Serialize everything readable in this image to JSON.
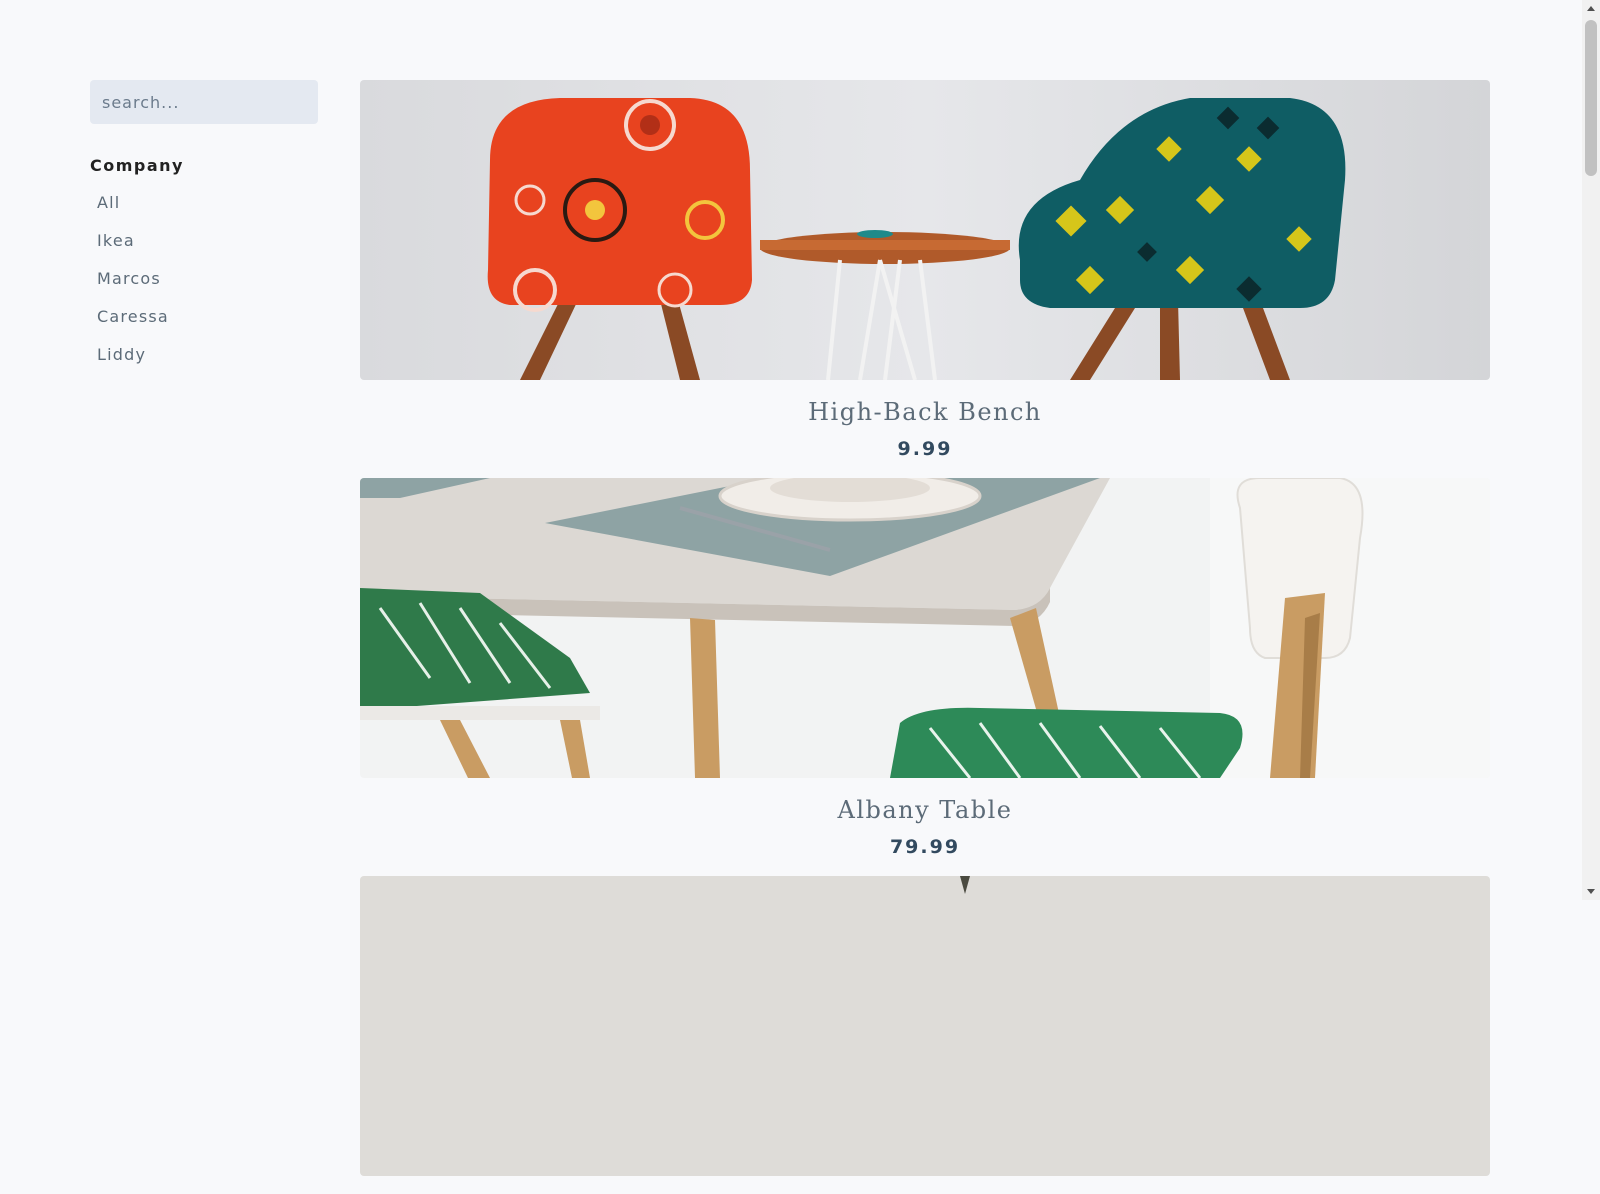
{
  "search": {
    "placeholder": "search..."
  },
  "sidebar": {
    "title": "Company",
    "items": [
      {
        "label": "All"
      },
      {
        "label": "Ikea"
      },
      {
        "label": "Marcos"
      },
      {
        "label": "Caressa"
      },
      {
        "label": "Liddy"
      }
    ]
  },
  "products": [
    {
      "name": "High-Back Bench",
      "price": "9.99",
      "image": "two-patterned-armchairs-with-side-table"
    },
    {
      "name": "Albany Table",
      "price": "79.99",
      "image": "white-dining-table-with-chair-and-cushions"
    },
    {
      "name": "",
      "price": "",
      "image": "partially-visible-product-image"
    }
  ],
  "colors": {
    "background": "#f8f9fb",
    "search_bg": "#e4e9f1",
    "title_text": "#5c6b78",
    "price_text": "#324a5f"
  }
}
